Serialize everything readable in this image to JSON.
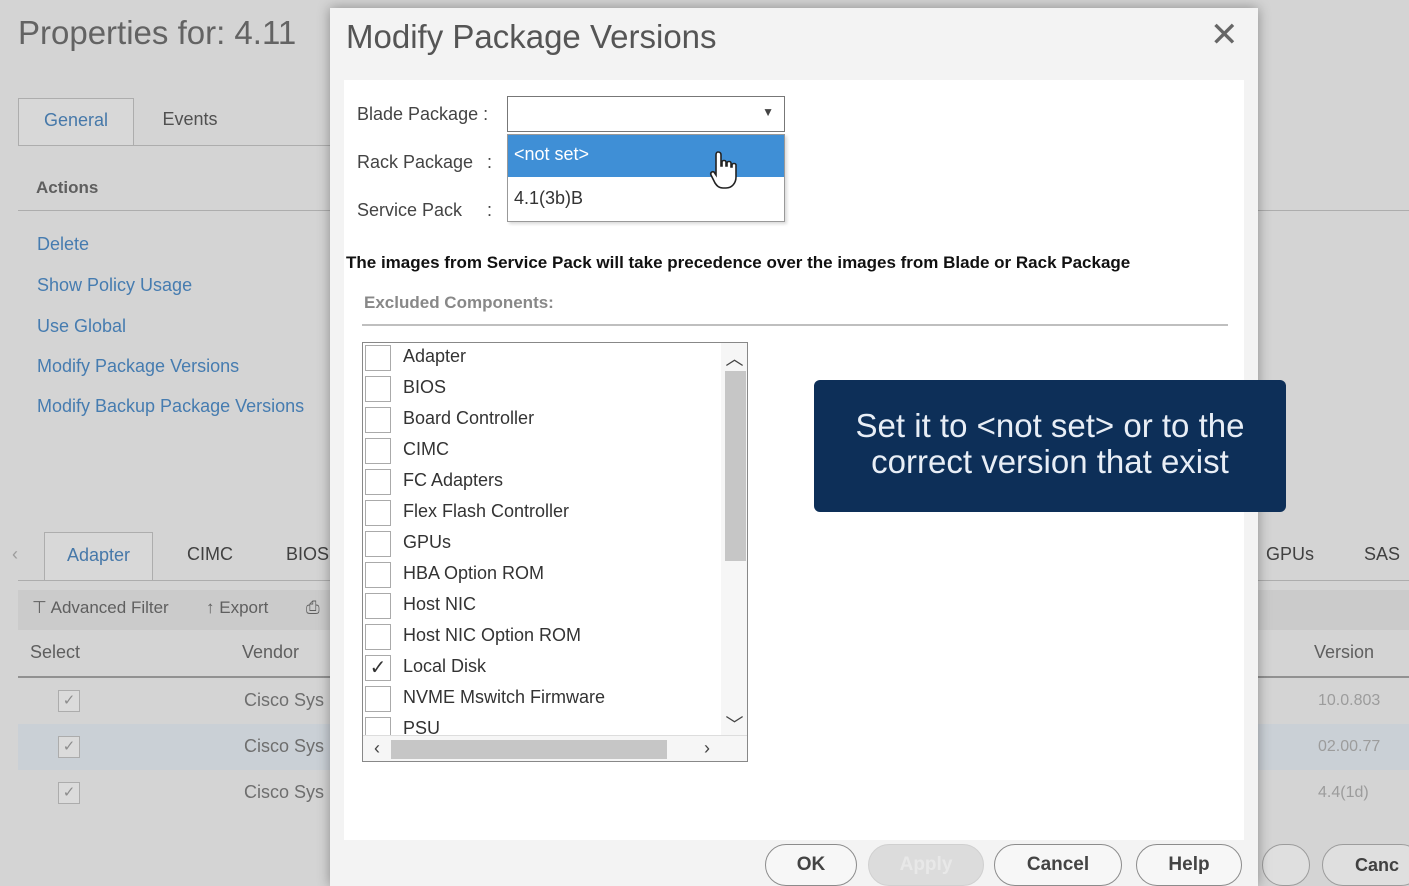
{
  "background": {
    "title": "Properties for: 4.11",
    "tabs": [
      "General",
      "Events"
    ],
    "actions_heading": "Actions",
    "actions": [
      "Delete",
      "Show Policy Usage",
      "Use Global",
      "Modify Package Versions",
      "Modify Backup Package Versions"
    ],
    "sub_tabs": [
      "Adapter",
      "CIMC",
      "BIOS",
      "GPUs",
      "SAS"
    ],
    "toolbar": {
      "advanced_filter": "Advanced Filter",
      "export": "Export"
    },
    "columns": {
      "select": "Select",
      "vendor": "Vendor",
      "version": "Version"
    },
    "rows": [
      {
        "vendor": "Cisco Sys",
        "version": "10.0.803"
      },
      {
        "vendor": "Cisco Sys",
        "version": "02.00.77"
      },
      {
        "vendor": "Cisco Sys",
        "version": "4.4(1d)"
      }
    ],
    "cancel_label": "Canc"
  },
  "modal": {
    "title": "Modify Package Versions",
    "close_icon": "close-icon",
    "blade_package_label": "Blade Package :",
    "rack_package_label": "Rack Package",
    "service_pack_label": "Service Pack",
    "colon": ":",
    "blade_package_value": "",
    "dropdown_options": [
      "<not set>",
      "4.1(3b)B"
    ],
    "dropdown_selected": "<not set>",
    "notice": "The images from Service Pack will take precedence over the images from Blade or Rack Package",
    "excluded_label": "Excluded Components:",
    "components": [
      {
        "label": "Adapter",
        "checked": false
      },
      {
        "label": "BIOS",
        "checked": false
      },
      {
        "label": "Board Controller",
        "checked": false
      },
      {
        "label": "CIMC",
        "checked": false
      },
      {
        "label": "FC Adapters",
        "checked": false
      },
      {
        "label": "Flex Flash Controller",
        "checked": false
      },
      {
        "label": "GPUs",
        "checked": false
      },
      {
        "label": "HBA Option ROM",
        "checked": false
      },
      {
        "label": "Host NIC",
        "checked": false
      },
      {
        "label": "Host NIC Option ROM",
        "checked": false
      },
      {
        "label": "Local Disk",
        "checked": true
      },
      {
        "label": "NVME Mswitch Firmware",
        "checked": false
      },
      {
        "label": "PSU",
        "checked": false
      }
    ],
    "buttons": {
      "ok": "OK",
      "apply": "Apply",
      "cancel": "Cancel",
      "help": "Help"
    }
  },
  "callout": {
    "line1": "Set it to <not set> or to the",
    "line2": "correct version that exist",
    "bg_color": "#0d2f58"
  },
  "colors": {
    "accent": "#3f8fd6",
    "link": "#4a86c0"
  }
}
